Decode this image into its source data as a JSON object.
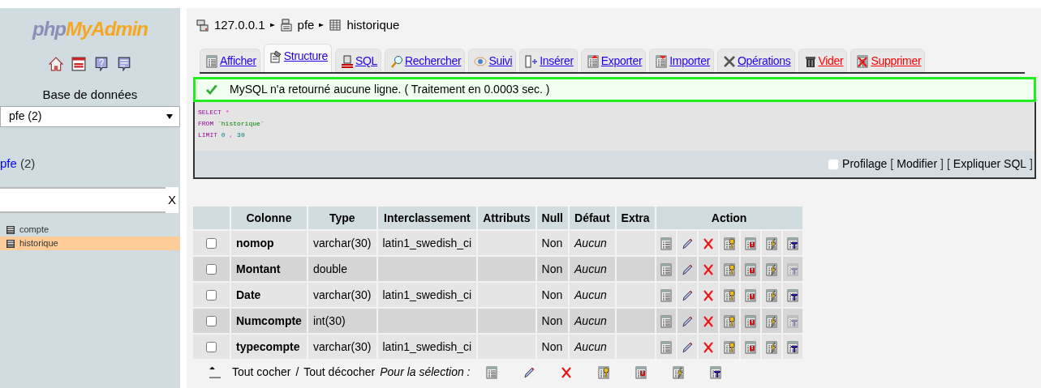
{
  "sidebar": {
    "logo": {
      "part_1": "php",
      "part_2": "MyAdmin"
    },
    "database_label": "Base de données",
    "database_select": {
      "value": "pfe (2)"
    },
    "database_link": {
      "name": "pfe",
      "count": "(2)"
    },
    "filter": {
      "clear": "X"
    },
    "tables": [
      {
        "name": "compte",
        "selected": false
      },
      {
        "name": "historique",
        "selected": true
      }
    ]
  },
  "breadcrumb": [
    {
      "label": "127.0.0.1",
      "kind": "server"
    },
    {
      "label": "pfe",
      "kind": "database"
    },
    {
      "label": "historique",
      "kind": "table"
    }
  ],
  "tabs": [
    {
      "label": "Afficher",
      "kind": "browse",
      "selected": false,
      "danger": false
    },
    {
      "label": "Structure",
      "kind": "structure",
      "selected": true,
      "danger": false
    },
    {
      "label": "SQL",
      "kind": "sql",
      "selected": false,
      "danger": false
    },
    {
      "label": "Rechercher",
      "kind": "search",
      "selected": false,
      "danger": false
    },
    {
      "label": "Suivi",
      "kind": "track",
      "selected": false,
      "danger": false
    },
    {
      "label": "Insérer",
      "kind": "insert",
      "selected": false,
      "danger": false
    },
    {
      "label": "Exporter",
      "kind": "export",
      "selected": false,
      "danger": false
    },
    {
      "label": "Importer",
      "kind": "import",
      "selected": false,
      "danger": false
    },
    {
      "label": "Opérations",
      "kind": "operations",
      "selected": false,
      "danger": false
    },
    {
      "label": "Vider",
      "kind": "empty",
      "selected": false,
      "danger": true
    },
    {
      "label": "Supprimer",
      "kind": "drop",
      "selected": false,
      "danger": true
    }
  ],
  "message": "MySQL n'a retourné aucune ligne. ( Traitement en 0.0003 sec. )",
  "sql": {
    "lines": [
      [
        {
          "kind": "keyword",
          "text": "SELECT"
        },
        {
          "kind": "operator",
          "text": "*"
        }
      ],
      [
        {
          "kind": "keyword",
          "text": "FROM"
        },
        {
          "kind": "identifier",
          "text": "`historique`"
        }
      ],
      [
        {
          "kind": "keyword",
          "text": "LIMIT"
        },
        {
          "kind": "number",
          "text": "0"
        },
        {
          "kind": "operator",
          "text": ","
        },
        {
          "kind": "number",
          "text": "30"
        }
      ]
    ]
  },
  "sql_options": {
    "profiling": {
      "label": "Profilage",
      "checked": false
    },
    "links": [
      {
        "open": "[",
        "label": "Modifier",
        "close": "]"
      },
      {
        "open": "[",
        "label": "Expliquer SQL",
        "close": "]"
      }
    ]
  },
  "structure": {
    "columns": [
      "Colonne",
      "Type",
      "Interclassement",
      "Attributs",
      "Null",
      "Défaut",
      "Extra",
      "Action"
    ],
    "rows": [
      {
        "checked": false,
        "name": "nomop",
        "type": "varchar(30)",
        "collation": "latin1_swedish_ci",
        "null": "Non",
        "default": "Aucun",
        "fulltext_enabled": true
      },
      {
        "checked": false,
        "name": "Montant",
        "type": "double",
        "null": "Non",
        "default": "Aucun",
        "fulltext_enabled": false
      },
      {
        "checked": false,
        "name": "Date",
        "type": "varchar(30)",
        "collation": "latin1_swedish_ci",
        "null": "Non",
        "default": "Aucun",
        "fulltext_enabled": true
      },
      {
        "checked": false,
        "name": "Numcompte",
        "type": "int(30)",
        "null": "Non",
        "default": "Aucun",
        "fulltext_enabled": false
      },
      {
        "checked": false,
        "name": "typecompte",
        "type": "varchar(30)",
        "collation": "latin1_swedish_ci",
        "null": "Non",
        "default": "Aucun",
        "fulltext_enabled": true
      }
    ]
  },
  "footer": {
    "check_all": "Tout cocher",
    "separator": "/",
    "uncheck_all": "Tout décocher",
    "with_selected": "Pour la sélection :"
  }
}
